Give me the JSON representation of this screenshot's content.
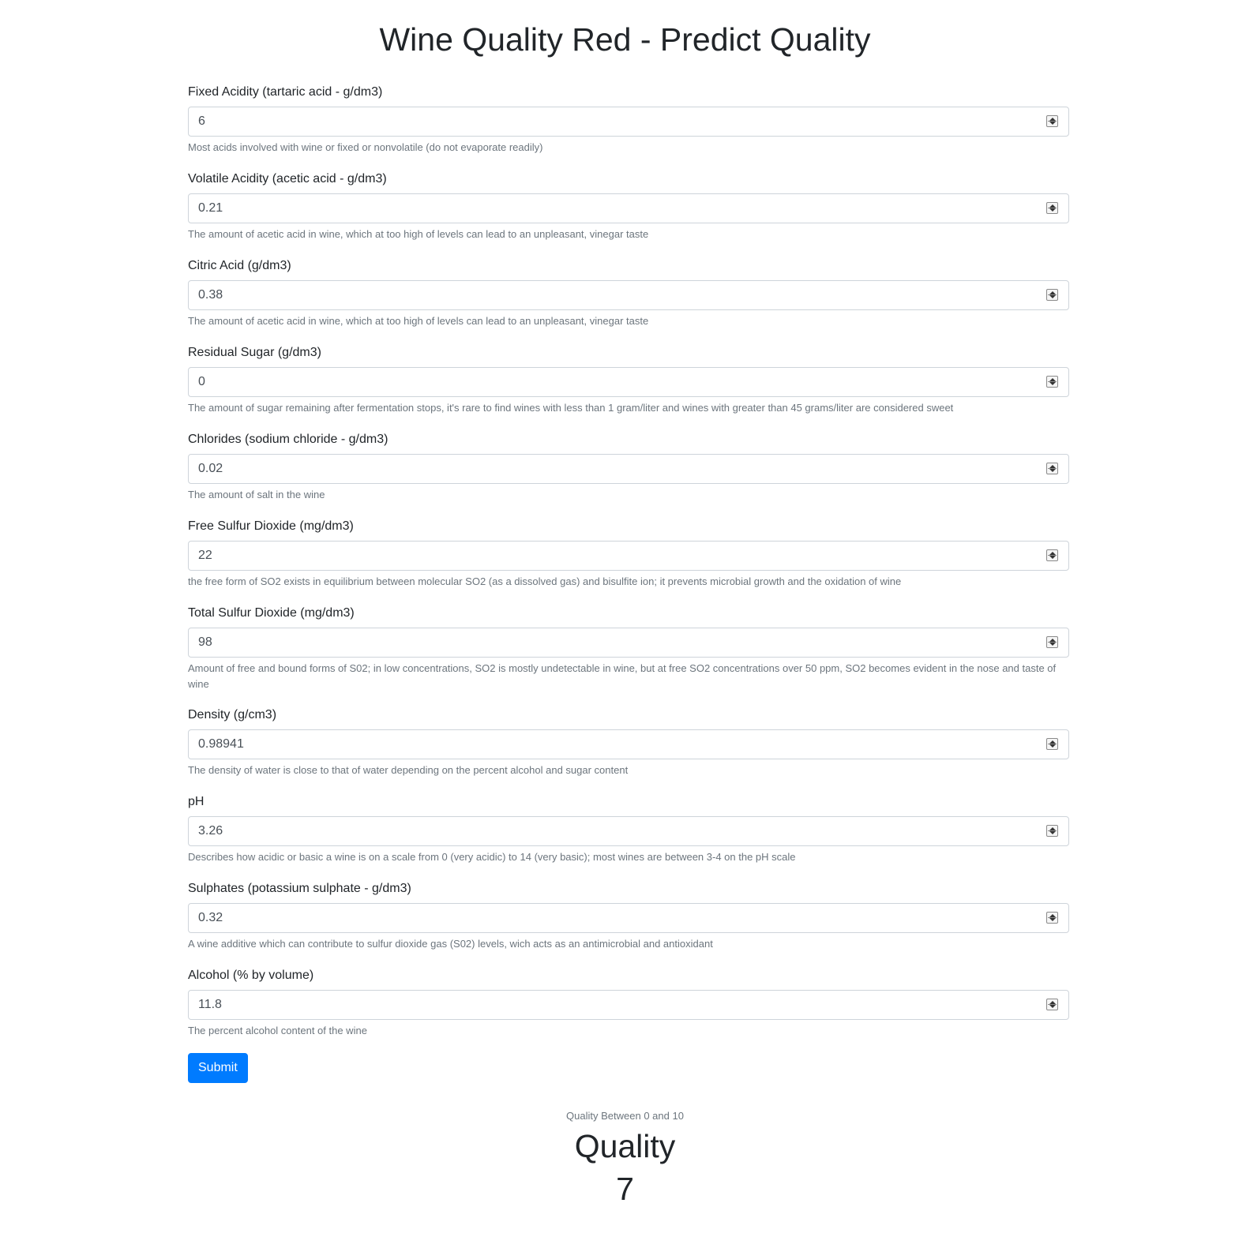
{
  "page": {
    "title": "Wine Quality Red - Predict Quality"
  },
  "form": {
    "fields": [
      {
        "label": "Fixed Acidity (tartaric acid - g/dm3)",
        "value": "6",
        "help": "Most acids involved with wine or fixed or nonvolatile (do not evaporate readily)"
      },
      {
        "label": "Volatile Acidity (acetic acid - g/dm3)",
        "value": "0.21",
        "help": "The amount of acetic acid in wine, which at too high of levels can lead to an unpleasant, vinegar taste"
      },
      {
        "label": "Citric Acid (g/dm3)",
        "value": "0.38",
        "help": "The amount of acetic acid in wine, which at too high of levels can lead to an unpleasant, vinegar taste"
      },
      {
        "label": "Residual Sugar (g/dm3)",
        "value": "0",
        "help": "The amount of sugar remaining after fermentation stops, it's rare to find wines with less than 1 gram/liter and wines with greater than 45 grams/liter are considered sweet"
      },
      {
        "label": "Chlorides (sodium chloride - g/dm3)",
        "value": "0.02",
        "help": "The amount of salt in the wine"
      },
      {
        "label": "Free Sulfur Dioxide (mg/dm3)",
        "value": "22",
        "help": "the free form of SO2 exists in equilibrium between molecular SO2 (as a dissolved gas) and bisulfite ion; it prevents microbial growth and the oxidation of wine"
      },
      {
        "label": "Total Sulfur Dioxide (mg/dm3)",
        "value": "98",
        "help": "Amount of free and bound forms of S02; in low concentrations, SO2 is mostly undetectable in wine, but at free SO2 concentrations over 50 ppm, SO2 becomes evident in the nose and taste of wine"
      },
      {
        "label": "Density (g/cm3)",
        "value": "0.98941",
        "help": "The density of water is close to that of water depending on the percent alcohol and sugar content"
      },
      {
        "label": "pH",
        "value": "3.26",
        "help": "Describes how acidic or basic a wine is on a scale from 0 (very acidic) to 14 (very basic); most wines are between 3-4 on the pH scale"
      },
      {
        "label": "Sulphates (potassium sulphate - g/dm3)",
        "value": "0.32",
        "help": "A wine additive which can contribute to sulfur dioxide gas (S02) levels, wich acts as an antimicrobial and antioxidant"
      },
      {
        "label": "Alcohol (% by volume)",
        "value": "11.8",
        "help": "The percent alcohol content of the wine"
      }
    ],
    "submit_label": "Submit"
  },
  "result": {
    "caption": "Quality Between 0 and 10",
    "heading": "Quality",
    "value": "7"
  }
}
